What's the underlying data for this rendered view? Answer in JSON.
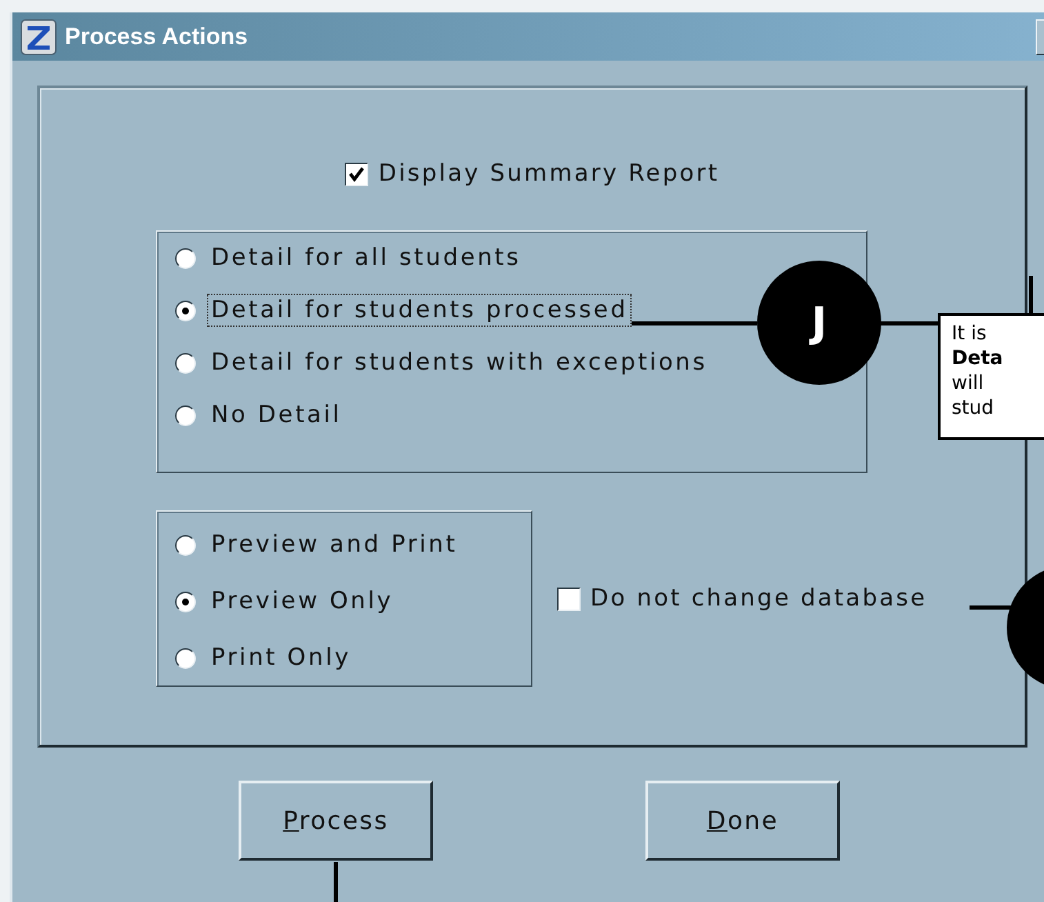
{
  "window": {
    "title": "Process Actions"
  },
  "summary_checkbox": {
    "label": "Display Summary Report",
    "checked": true
  },
  "detail_options": [
    {
      "label": "Detail for all students",
      "selected": false,
      "focused": false
    },
    {
      "label": "Detail for students processed",
      "selected": true,
      "focused": true
    },
    {
      "label": "Detail for students with exceptions",
      "selected": false,
      "focused": false
    },
    {
      "label": "No Detail",
      "selected": false,
      "focused": false
    }
  ],
  "output_options": [
    {
      "label": "Preview and Print",
      "selected": false
    },
    {
      "label": "Preview Only",
      "selected": true
    },
    {
      "label": "Print Only",
      "selected": false
    }
  ],
  "database_checkbox": {
    "label": "Do not change database",
    "checked": false
  },
  "buttons": [
    {
      "label": "Process"
    },
    {
      "label": "Done"
    }
  ],
  "callout": {
    "letter": "J",
    "note_lines": [
      "It is",
      "**Deta**",
      "will",
      "stud"
    ]
  }
}
